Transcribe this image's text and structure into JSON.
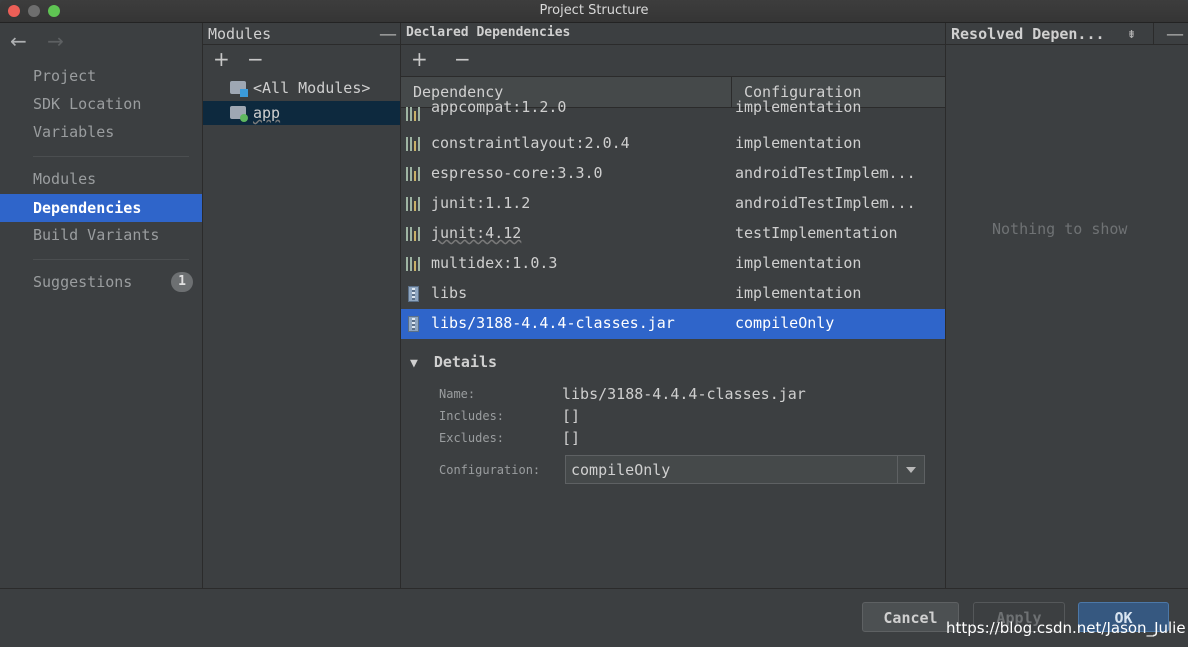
{
  "window": {
    "title": "Project Structure"
  },
  "nav": {
    "back_arrow": "←",
    "forward_arrow": "→",
    "items": [
      {
        "label": "Project"
      },
      {
        "label": "SDK Location"
      },
      {
        "label": "Variables"
      },
      {
        "label": "Modules"
      },
      {
        "label": "Dependencies",
        "active": true
      },
      {
        "label": "Build Variants"
      },
      {
        "label": "Suggestions",
        "badge": "1"
      }
    ]
  },
  "modules": {
    "title": "Modules",
    "add": "+",
    "remove": "−",
    "collapse": "—",
    "items": [
      {
        "label": "<All Modules>",
        "icon": "folder-modules-icon"
      },
      {
        "label": "app",
        "icon": "folder-app-icon",
        "selected": true
      }
    ]
  },
  "declared": {
    "title": "Declared Dependencies",
    "add": "+",
    "remove": "−",
    "columns": {
      "dependency": "Dependency",
      "configuration": "Configuration"
    },
    "rows": [
      {
        "dependency": "appcompat:1.2.0",
        "configuration": "implementation",
        "icon": "library-icon"
      },
      {
        "dependency": "constraintlayout:2.0.4",
        "configuration": "implementation",
        "icon": "library-icon"
      },
      {
        "dependency": "espresso-core:3.3.0",
        "configuration": "androidTestImplem...",
        "icon": "library-icon"
      },
      {
        "dependency": "junit:1.1.2",
        "configuration": "androidTestImplem...",
        "icon": "library-icon"
      },
      {
        "dependency": "junit:4.12",
        "configuration": "testImplementation",
        "icon": "library-icon"
      },
      {
        "dependency": "multidex:1.0.3",
        "configuration": "implementation",
        "icon": "library-icon"
      },
      {
        "dependency": "libs",
        "configuration": "implementation",
        "icon": "jar-icon"
      },
      {
        "dependency": "libs/3188-4.4.4-classes.jar",
        "configuration": "compileOnly",
        "icon": "jar-icon",
        "selected": true
      }
    ],
    "details": {
      "title": "Details",
      "name_label": "Name:",
      "name_value": "libs/3188-4.4.4-classes.jar",
      "includes_label": "Includes:",
      "includes_value": "[]",
      "excludes_label": "Excludes:",
      "excludes_value": "[]",
      "configuration_label": "Configuration:",
      "configuration_value": "compileOnly"
    }
  },
  "resolved": {
    "title": "Resolved Depen...",
    "empty_text": "Nothing to show",
    "collapse": "—"
  },
  "footer": {
    "cancel": "Cancel",
    "apply": "Apply",
    "ok": "OK",
    "watermark": "https://blog.csdn.net/Jason_Julie"
  },
  "colors": {
    "selection": "#2f65ca",
    "background": "#3c3f41",
    "tree_selection": "#0d293e",
    "ok_button": "#365880"
  }
}
